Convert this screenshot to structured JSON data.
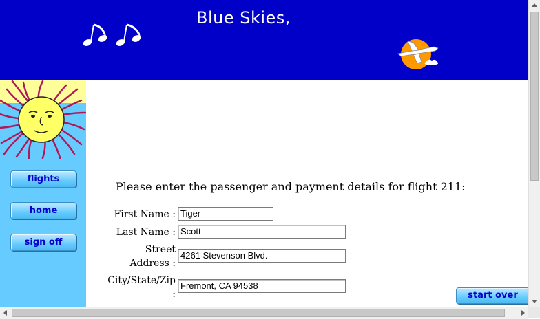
{
  "banner": {
    "title": "Blue Skies,"
  },
  "colors": {
    "banner": "#0000c8",
    "sidebar": "#66ccff",
    "button_text": "#0000cc",
    "sun_face": "#ffff66",
    "sun_rays": "#b0185a",
    "logo_circle": "#ff9900"
  },
  "icons": [
    "music-notes-icon",
    "airplane-logo-icon",
    "sun-face-icon"
  ],
  "nav": {
    "flights": "flights",
    "home": "home",
    "sign_off": "sign off"
  },
  "form": {
    "heading": "Please enter the passenger and payment details for flight 211:",
    "first_name": {
      "label": "First Name :",
      "value": "Tiger"
    },
    "last_name": {
      "label": "Last Name :",
      "value": "Scott"
    },
    "street": {
      "label_line1": "Street",
      "label_line2": "Address :",
      "value": "4261 Stevenson Blvd."
    },
    "city": {
      "label_line1": "City/State/Zip",
      "label_line2": ":",
      "value": "Fremont, CA 94538"
    }
  },
  "actions": {
    "start_over": "start over"
  }
}
